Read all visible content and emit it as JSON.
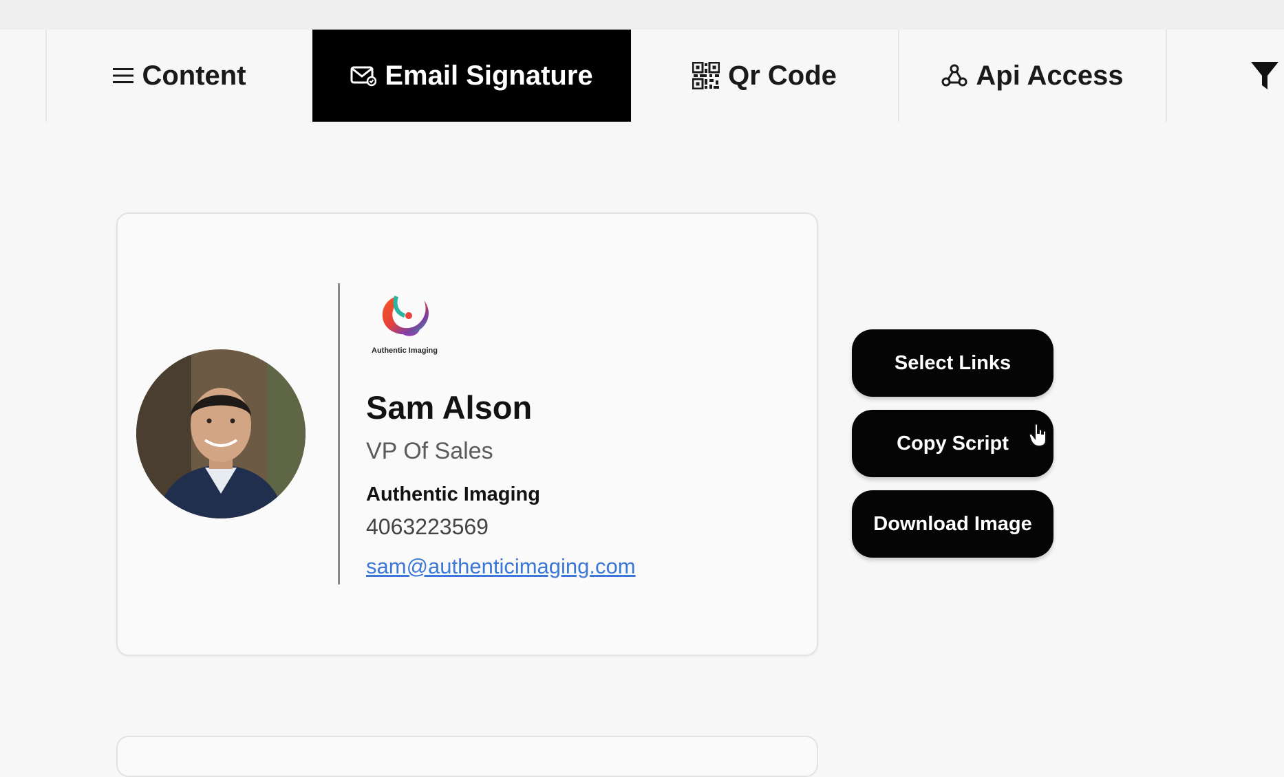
{
  "tabs": [
    {
      "label": "Content",
      "icon": "menu-icon",
      "active": false
    },
    {
      "label": "Email Signature",
      "icon": "mail-icon",
      "active": true
    },
    {
      "label": "Qr Code",
      "icon": "qr-code-icon",
      "active": false
    },
    {
      "label": "Api Access",
      "icon": "webhook-icon",
      "active": false
    }
  ],
  "filter_icon": "filter-icon",
  "signature": {
    "logo_text": "Authentic Imaging",
    "name": "Sam Alson",
    "role": "VP Of Sales",
    "company": "Authentic Imaging",
    "phone": "4063223569",
    "email": "sam@authenticimaging.com"
  },
  "actions": {
    "select_links": "Select Links",
    "copy_script": "Copy Script",
    "download_image": "Download Image"
  },
  "colors": {
    "active_tab_bg": "#000000",
    "button_bg": "#050505",
    "link": "#3c78d8",
    "page_bg": "#f7f7f7"
  }
}
